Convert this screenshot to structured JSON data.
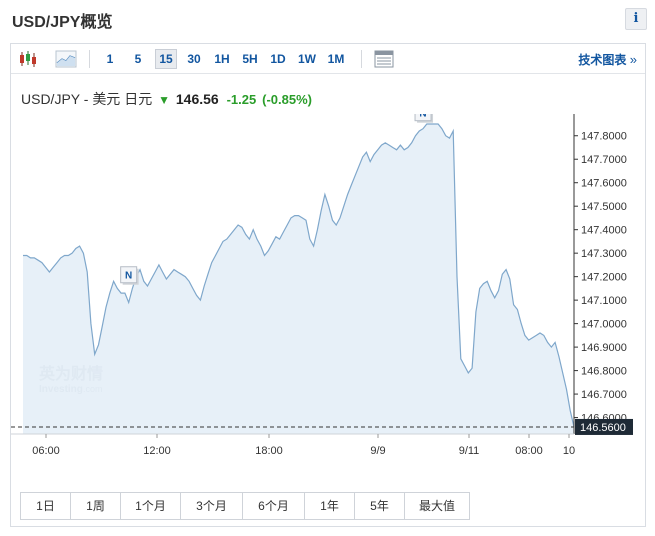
{
  "header": {
    "title": "USD/JPY概览",
    "info_label": "i"
  },
  "toolbar": {
    "timeframes": [
      "1",
      "5",
      "15",
      "30",
      "1H",
      "5H",
      "1D",
      "1W",
      "1M"
    ],
    "active_timeframe": "15",
    "tech_chart_label": "技术图表",
    "tech_chart_arrow": "»"
  },
  "quote": {
    "pair": "USD/JPY - 美元 日元",
    "direction_icon": "down-arrow-icon",
    "price": "146.56",
    "change": "-1.25",
    "change_pct": "(-0.85%)",
    "change_color": "#2a9d2a"
  },
  "watermark": {
    "brand": "英为财情",
    "sub": "Investing",
    "sub_suffix": ".com"
  },
  "news_marker_label": "N",
  "chart_data": {
    "type": "area",
    "line_color": "#7fa7cb",
    "fill_color": "#e3edf7",
    "current_price_label": "146.5600",
    "y_ticks": [
      "147.8000",
      "147.7000",
      "147.6000",
      "147.5000",
      "147.4000",
      "147.3000",
      "147.2000",
      "147.1000",
      "147.0000",
      "146.9000",
      "146.8000",
      "146.7000",
      "146.6000"
    ],
    "x_ticks": [
      "06:00",
      "12:00",
      "18:00",
      "9/9",
      "9/11",
      "08:00",
      "10"
    ],
    "ylim": [
      146.53,
      147.85
    ],
    "values": [
      147.29,
      147.29,
      147.28,
      147.28,
      147.27,
      147.26,
      147.24,
      147.22,
      147.24,
      147.26,
      147.28,
      147.29,
      147.29,
      147.3,
      147.32,
      147.33,
      147.3,
      147.22,
      147.0,
      146.87,
      146.91,
      146.99,
      147.07,
      147.13,
      147.18,
      147.15,
      147.13,
      147.13,
      147.09,
      147.15,
      147.2,
      147.23,
      147.18,
      147.16,
      147.19,
      147.22,
      147.25,
      147.22,
      147.19,
      147.21,
      147.23,
      147.22,
      147.21,
      147.2,
      147.18,
      147.15,
      147.12,
      147.1,
      147.16,
      147.21,
      147.26,
      147.29,
      147.32,
      147.35,
      147.36,
      147.38,
      147.4,
      147.42,
      147.41,
      147.38,
      147.36,
      147.4,
      147.36,
      147.33,
      147.29,
      147.31,
      147.34,
      147.37,
      147.36,
      147.39,
      147.42,
      147.45,
      147.46,
      147.46,
      147.45,
      147.44,
      147.36,
      147.33,
      147.4,
      147.48,
      147.55,
      147.5,
      147.44,
      147.42,
      147.45,
      147.5,
      147.55,
      147.59,
      147.63,
      147.67,
      147.71,
      147.73,
      147.69,
      147.72,
      147.74,
      147.76,
      147.77,
      147.76,
      147.75,
      147.74,
      147.76,
      147.74,
      147.75,
      147.77,
      147.8,
      147.82,
      147.83,
      147.85,
      147.85,
      147.85,
      147.85,
      147.83,
      147.8,
      147.79,
      147.82,
      147.2,
      146.85,
      146.82,
      146.79,
      146.81,
      147.05,
      147.15,
      147.17,
      147.18,
      147.14,
      147.11,
      147.14,
      147.21,
      147.23,
      147.19,
      147.08,
      147.06,
      147.0,
      146.95,
      146.93,
      146.94,
      146.95,
      146.96,
      146.95,
      146.92,
      146.9,
      146.92,
      146.86,
      146.79,
      146.72,
      146.63,
      146.56
    ],
    "news_markers": [
      {
        "index": 28,
        "value": 147.14
      },
      {
        "index": 106,
        "value": 147.83
      }
    ]
  },
  "ranges": [
    "1日",
    "1周",
    "1个月",
    "3个月",
    "6个月",
    "1年",
    "5年",
    "最大值"
  ]
}
